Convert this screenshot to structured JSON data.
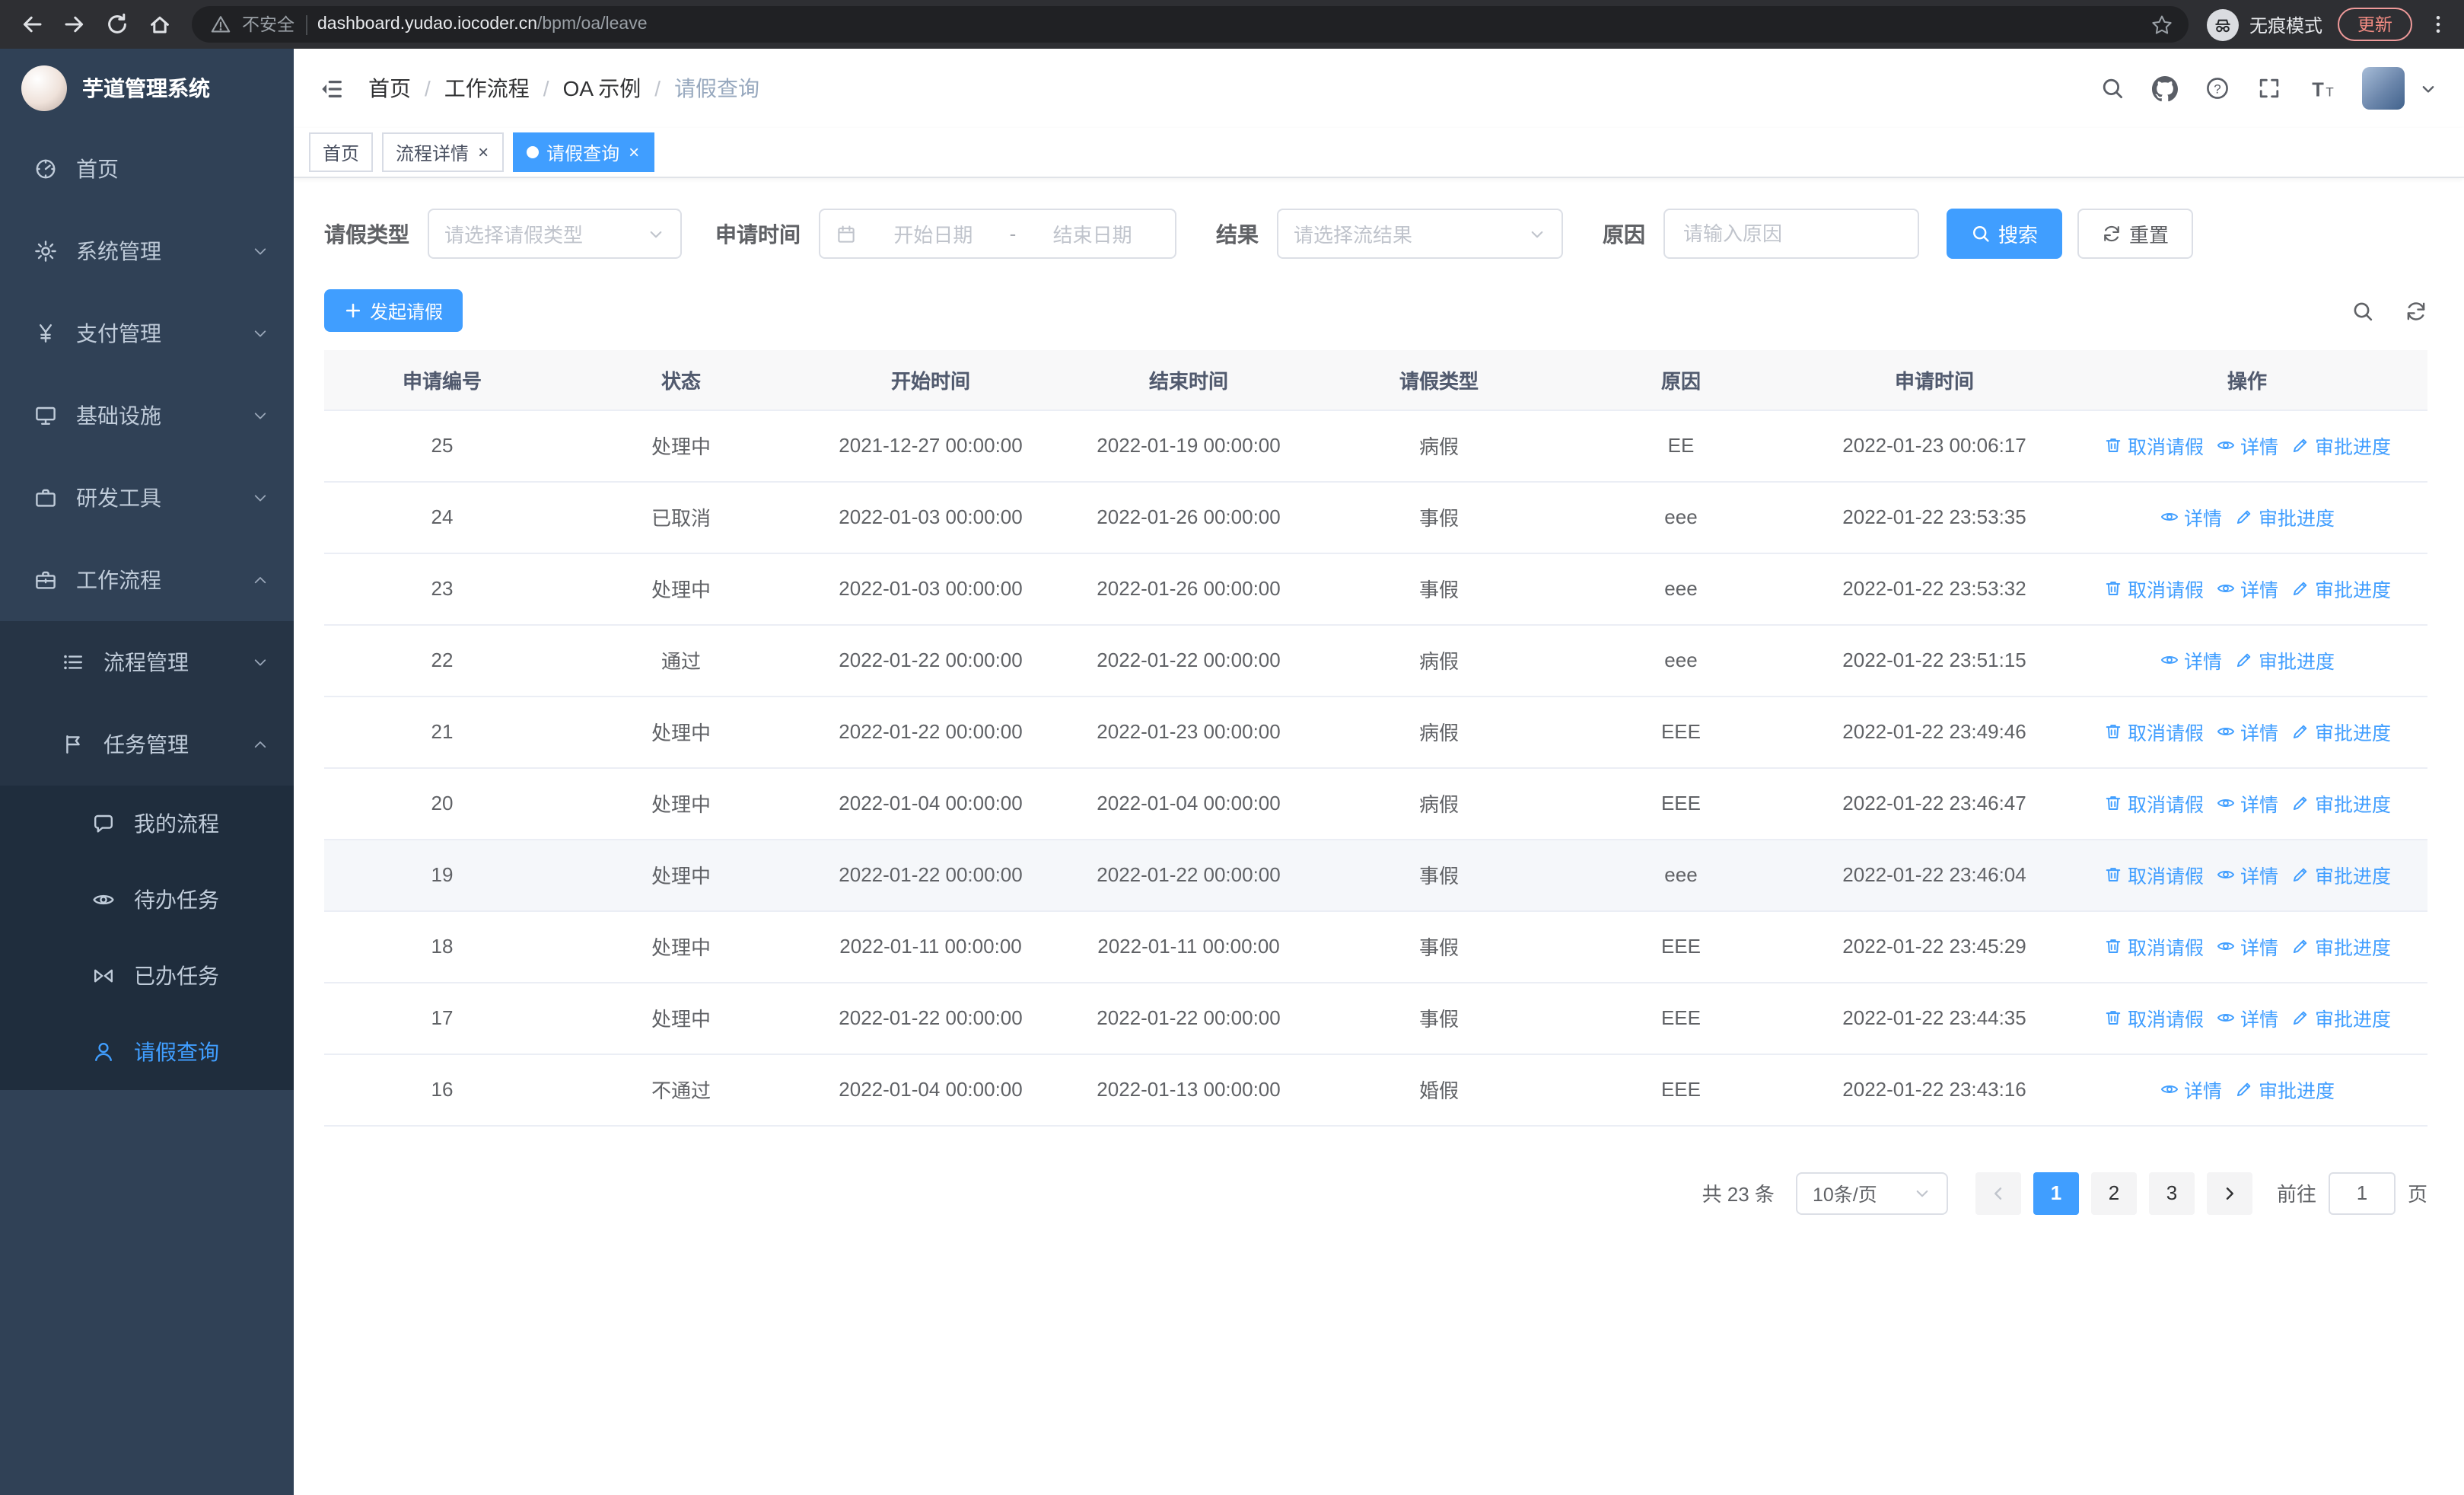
{
  "browser": {
    "security_warning": "不安全",
    "url_host": "dashboard.yudao.iocoder.cn",
    "url_path": "/bpm/oa/leave",
    "incognito_label": "无痕模式",
    "update_button": "更新"
  },
  "sidebar": {
    "logo_title": "芋道管理系统",
    "items": [
      {
        "key": "home",
        "label": "首页",
        "icon": "dashboard-icon",
        "level": 1
      },
      {
        "key": "system",
        "label": "系统管理",
        "icon": "gear-icon",
        "level": 1,
        "expandable": true
      },
      {
        "key": "payment",
        "label": "支付管理",
        "icon": "yen-icon",
        "level": 1,
        "expandable": true
      },
      {
        "key": "infrastructure",
        "label": "基础设施",
        "icon": "monitor-icon",
        "level": 1,
        "expandable": true
      },
      {
        "key": "devtools",
        "label": "研发工具",
        "icon": "toolbox-icon",
        "level": 1,
        "expandable": true
      },
      {
        "key": "workflow",
        "label": "工作流程",
        "icon": "briefcase-icon",
        "level": 1,
        "expandable": true,
        "expanded": true
      },
      {
        "key": "process-management",
        "label": "流程管理",
        "icon": "list-icon",
        "level": 2,
        "expandable": true
      },
      {
        "key": "task-management",
        "label": "任务管理",
        "icon": "flag-icon",
        "level": 2,
        "expandable": true,
        "expanded": true
      },
      {
        "key": "my-process",
        "label": "我的流程",
        "icon": "chat-icon",
        "level": 3
      },
      {
        "key": "todo-task",
        "label": "待办任务",
        "icon": "eye-icon",
        "level": 3
      },
      {
        "key": "done-task",
        "label": "已办任务",
        "icon": "bowtie-icon",
        "level": 3
      },
      {
        "key": "leave-query",
        "label": "请假查询",
        "icon": "user-icon",
        "level": 3,
        "active": true
      }
    ]
  },
  "header": {
    "breadcrumb": [
      "首页",
      "工作流程",
      "OA 示例",
      "请假查询"
    ]
  },
  "tabs": [
    {
      "key": "home",
      "label": "首页",
      "closable": false,
      "active": false
    },
    {
      "key": "process-detail",
      "label": "流程详情",
      "closable": true,
      "active": false
    },
    {
      "key": "leave-query",
      "label": "请假查询",
      "closable": true,
      "active": true
    }
  ],
  "filters": {
    "leave_type_label": "请假类型",
    "leave_type_placeholder": "请选择请假类型",
    "apply_time_label": "申请时间",
    "start_date_placeholder": "开始日期",
    "date_separator": "-",
    "end_date_placeholder": "结束日期",
    "result_label": "结果",
    "result_placeholder": "请选择流结果",
    "reason_label": "原因",
    "reason_placeholder": "请输入原因",
    "search_button": "搜索",
    "reset_button": "重置"
  },
  "toolbar": {
    "create_button": "发起请假"
  },
  "table": {
    "column_keys": [
      "apply-id",
      "status",
      "start-time",
      "end-time",
      "leave-type",
      "reason",
      "apply-time",
      "actions"
    ],
    "columns": [
      "申请编号",
      "状态",
      "开始时间",
      "结束时间",
      "请假类型",
      "原因",
      "申请时间",
      "操作"
    ],
    "actions": [
      {
        "key": "cancel-leave",
        "label": "取消请假",
        "icon": "trash-icon",
        "requires_cancellable": true
      },
      {
        "key": "detail",
        "label": "详情",
        "icon": "view-icon",
        "requires_cancellable": false
      },
      {
        "key": "approval-progress",
        "label": "审批进度",
        "icon": "edit-icon",
        "requires_cancellable": false
      }
    ],
    "rows": [
      {
        "id": "25",
        "status": "处理中",
        "start": "2021-12-27 00:00:00",
        "end": "2022-01-19 00:00:00",
        "type": "病假",
        "reason": "EE",
        "applied": "2022-01-23 00:06:17",
        "cancellable": true
      },
      {
        "id": "24",
        "status": "已取消",
        "start": "2022-01-03 00:00:00",
        "end": "2022-01-26 00:00:00",
        "type": "事假",
        "reason": "eee",
        "applied": "2022-01-22 23:53:35",
        "cancellable": false
      },
      {
        "id": "23",
        "status": "处理中",
        "start": "2022-01-03 00:00:00",
        "end": "2022-01-26 00:00:00",
        "type": "事假",
        "reason": "eee",
        "applied": "2022-01-22 23:53:32",
        "cancellable": true
      },
      {
        "id": "22",
        "status": "通过",
        "start": "2022-01-22 00:00:00",
        "end": "2022-01-22 00:00:00",
        "type": "病假",
        "reason": "eee",
        "applied": "2022-01-22 23:51:15",
        "cancellable": false
      },
      {
        "id": "21",
        "status": "处理中",
        "start": "2022-01-22 00:00:00",
        "end": "2022-01-23 00:00:00",
        "type": "病假",
        "reason": "EEE",
        "applied": "2022-01-22 23:49:46",
        "cancellable": true
      },
      {
        "id": "20",
        "status": "处理中",
        "start": "2022-01-04 00:00:00",
        "end": "2022-01-04 00:00:00",
        "type": "病假",
        "reason": "EEE",
        "applied": "2022-01-22 23:46:47",
        "cancellable": true
      },
      {
        "id": "19",
        "status": "处理中",
        "start": "2022-01-22 00:00:00",
        "end": "2022-01-22 00:00:00",
        "type": "事假",
        "reason": "eee",
        "applied": "2022-01-22 23:46:04",
        "cancellable": true
      },
      {
        "id": "18",
        "status": "处理中",
        "start": "2022-01-11 00:00:00",
        "end": "2022-01-11 00:00:00",
        "type": "事假",
        "reason": "EEE",
        "applied": "2022-01-22 23:45:29",
        "cancellable": true
      },
      {
        "id": "17",
        "status": "处理中",
        "start": "2022-01-22 00:00:00",
        "end": "2022-01-22 00:00:00",
        "type": "事假",
        "reason": "EEE",
        "applied": "2022-01-22 23:44:35",
        "cancellable": true
      },
      {
        "id": "16",
        "status": "不通过",
        "start": "2022-01-04 00:00:00",
        "end": "2022-01-13 00:00:00",
        "type": "婚假",
        "reason": "EEE",
        "applied": "2022-01-22 23:43:16",
        "cancellable": false
      }
    ]
  },
  "pagination": {
    "total_text": "共 23 条",
    "page_size": "10条/页",
    "pages": [
      "1",
      "2",
      "3"
    ],
    "active_page": "1",
    "goto_prefix": "前往",
    "goto_value": "1",
    "goto_suffix": "页"
  },
  "colors": {
    "accent": "#409eff",
    "sidebar_bg": "#304156",
    "sidebar_submenu_bg": "#1f2d3d",
    "table_header_bg": "#f8f8f9",
    "update_button_text": "#f28b82"
  }
}
